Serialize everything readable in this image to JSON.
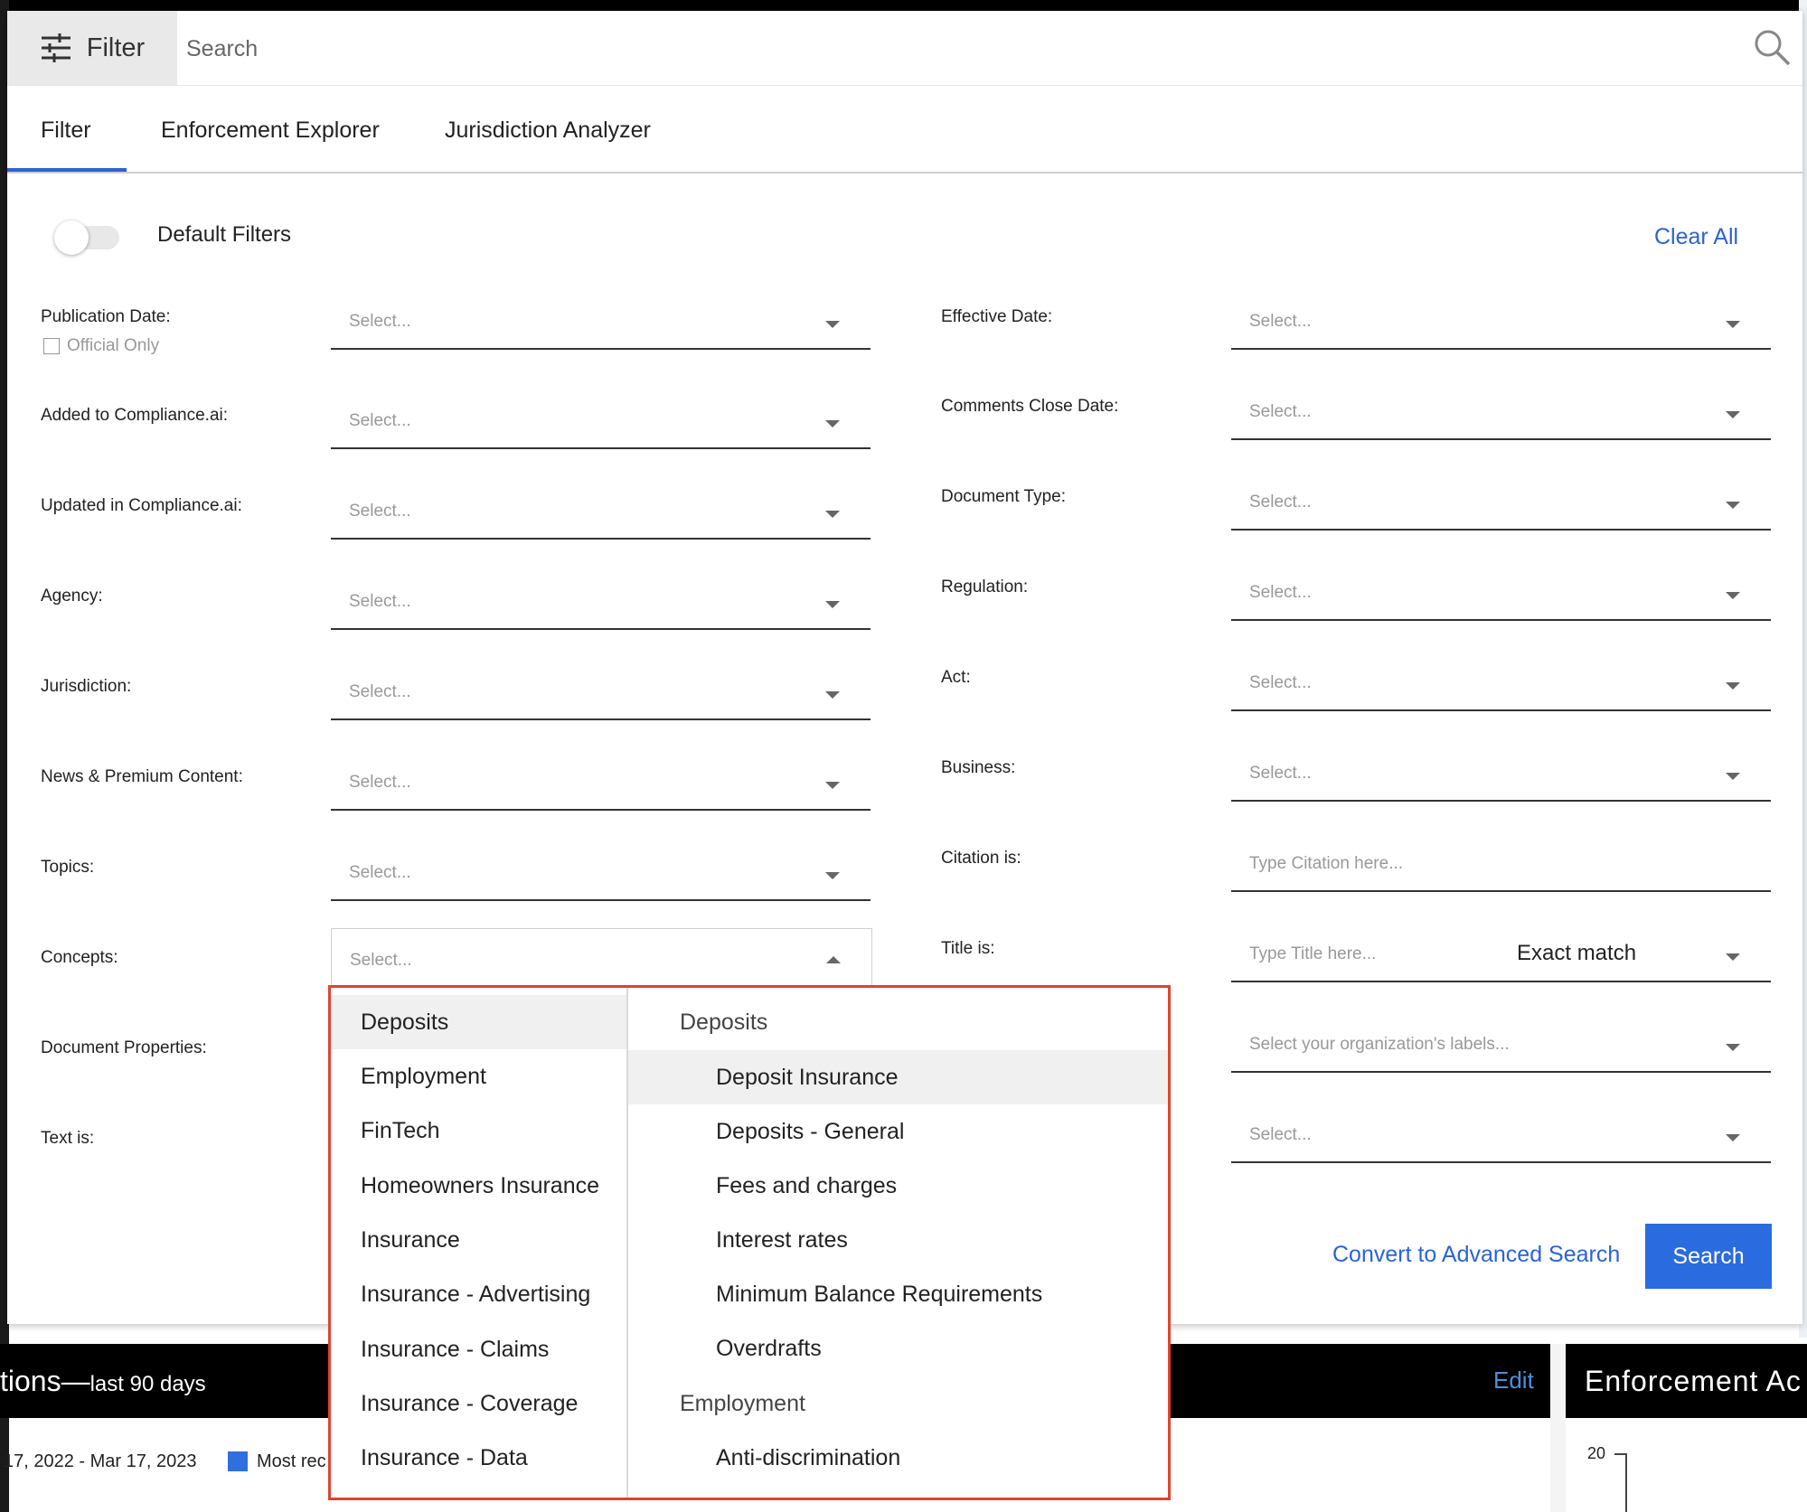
{
  "header": {
    "filter_button_label": "Filter",
    "search_placeholder": "Search"
  },
  "tabs": [
    {
      "label": "Filter",
      "active": true
    },
    {
      "label": "Enforcement Explorer",
      "active": false
    },
    {
      "label": "Jurisdiction Analyzer",
      "active": false
    }
  ],
  "default_filters": {
    "label": "Default Filters",
    "enabled": false
  },
  "clear_all_label": "Clear All",
  "official_only_label": "Official Only",
  "left_fields": [
    {
      "label": "Publication Date:",
      "placeholder": "Select..."
    },
    {
      "label": "Added to Compliance.ai:",
      "placeholder": "Select..."
    },
    {
      "label": "Updated in Compliance.ai:",
      "placeholder": "Select..."
    },
    {
      "label": "Agency:",
      "placeholder": "Select..."
    },
    {
      "label": "Jurisdiction:",
      "placeholder": "Select..."
    },
    {
      "label": "News & Premium Content:",
      "placeholder": "Select..."
    },
    {
      "label": "Topics:",
      "placeholder": "Select..."
    },
    {
      "label": "Concepts:",
      "placeholder": "Select..."
    },
    {
      "label": "Document Properties:",
      "placeholder": ""
    },
    {
      "label": "Text is:",
      "placeholder": ""
    }
  ],
  "right_fields": [
    {
      "label": "Effective Date:",
      "placeholder": "Select..."
    },
    {
      "label": "Comments Close Date:",
      "placeholder": "Select..."
    },
    {
      "label": "Document Type:",
      "placeholder": "Select..."
    },
    {
      "label": "Regulation:",
      "placeholder": "Select..."
    },
    {
      "label": "Act:",
      "placeholder": "Select..."
    },
    {
      "label": "Business:",
      "placeholder": "Select..."
    },
    {
      "label": "Citation is:",
      "placeholder": "Type Citation here..."
    },
    {
      "label": "Title is:",
      "placeholder": "Type Title here...",
      "match": "Exact match"
    },
    {
      "label": "",
      "placeholder": "Select your organization's labels..."
    },
    {
      "label": "",
      "placeholder": "Select..."
    }
  ],
  "actions": {
    "convert_label": "Convert to Advanced Search",
    "search_label": "Search"
  },
  "concepts_dropdown": {
    "categories": [
      "Deposits",
      "Employment",
      "FinTech",
      "Homeowners Insurance",
      "Insurance",
      "Insurance - Advertising",
      "Insurance - Claims",
      "Insurance - Coverage",
      "Insurance - Data"
    ],
    "groups": [
      {
        "name": "Deposits",
        "items": [
          "Deposit Insurance",
          "Deposits - General",
          "Fees and charges",
          "Interest rates",
          "Minimum Balance Requirements",
          "Overdrafts"
        ]
      },
      {
        "name": "Employment",
        "items": [
          "Anti-discrimination"
        ]
      }
    ]
  },
  "background": {
    "widget_title": "tions—",
    "widget_subtitle": "last 90 days",
    "edit_label": "Edit",
    "enforcement_title": "Enforcement Ac",
    "date_range": "17, 2022 - Mar 17, 2023",
    "legend_label": "Most rec",
    "axis_tick": "20"
  },
  "colors": {
    "accent": "#2b63d6",
    "highlight_border": "#e0432f"
  }
}
